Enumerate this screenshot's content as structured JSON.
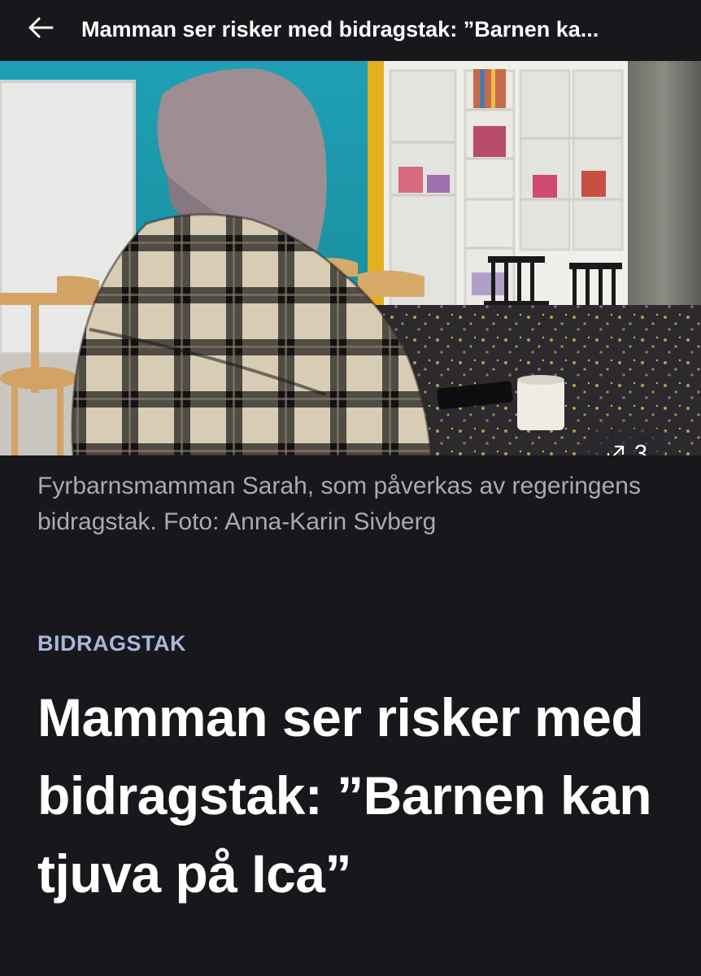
{
  "header": {
    "back_icon": "arrow-left-icon",
    "title": "Mamman ser risker med bidragstak: ”Barnen ka..."
  },
  "hero": {
    "gallery_icon": "expand-arrows-icon",
    "gallery_count": "3"
  },
  "caption": "Fyrbarnsmamman Sarah, som påverkas av regeringens bidragstak. Foto: Anna-Karin Sivberg",
  "article": {
    "kicker": "BIDRAGSTAK",
    "headline": "Mamman ser risker med bidragstak: ”Barnen kan tjuva på Ica”"
  },
  "colors": {
    "background": "#18181c",
    "caption": "#a9aab2",
    "kicker": "#a8b6da",
    "headline": "#ffffff"
  }
}
